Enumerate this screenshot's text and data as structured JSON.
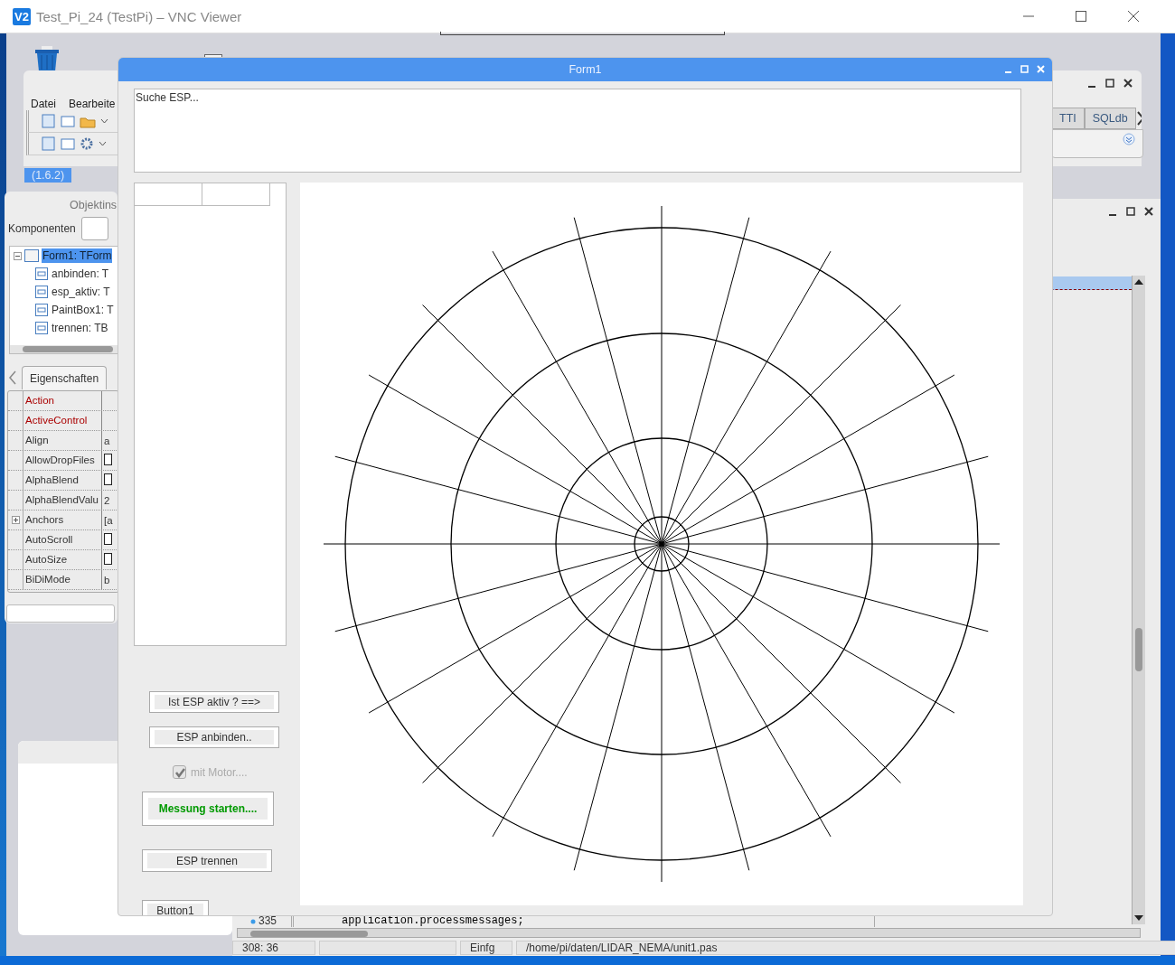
{
  "viewer": {
    "logo": "V2",
    "title": "Test_Pi_24 (TestPi) – VNC Viewer"
  },
  "ide_main": {
    "menu": [
      "Datei",
      "Bearbeite"
    ],
    "version": "(1.6.2)",
    "palette_tabs": [
      {
        "label": "TTI",
        "selected": false
      },
      {
        "label": "SQLdb",
        "selected": false
      }
    ]
  },
  "object_inspector": {
    "title": "Objektins",
    "components_label": "Komponenten",
    "tree": [
      {
        "label": "Form1: TForm",
        "selected": true,
        "expanded": true,
        "children": [
          {
            "label": "anbinden: T",
            "selected": false
          },
          {
            "label": "esp_aktiv: T",
            "selected": false
          },
          {
            "label": "PaintBox1: T",
            "selected": false
          },
          {
            "label": "trennen: TB",
            "selected": false
          }
        ]
      }
    ],
    "tab": "Eigenschaften",
    "properties": [
      {
        "name": "Action",
        "highlighted": true,
        "kind": "text"
      },
      {
        "name": "ActiveControl",
        "highlighted": true,
        "kind": "text"
      },
      {
        "name": "Align",
        "highlighted": false,
        "kind": "text",
        "value": "a"
      },
      {
        "name": "AllowDropFiles",
        "highlighted": false,
        "kind": "checkbox",
        "checked": false
      },
      {
        "name": "AlphaBlend",
        "highlighted": false,
        "kind": "checkbox",
        "checked": false
      },
      {
        "name": "AlphaBlendValu",
        "highlighted": false,
        "kind": "text",
        "value": "2"
      },
      {
        "name": "Anchors",
        "highlighted": false,
        "kind": "text",
        "value": "[a",
        "expandable": true
      },
      {
        "name": "AutoScroll",
        "highlighted": false,
        "kind": "checkbox",
        "checked": false
      },
      {
        "name": "AutoSize",
        "highlighted": false,
        "kind": "checkbox",
        "checked": false
      },
      {
        "name": "BiDiMode",
        "highlighted": false,
        "kind": "text",
        "value": "b"
      }
    ]
  },
  "editor": {
    "line_number": "335",
    "code": "application.processmessages;",
    "status_bar": [
      "308:  36",
      "Einfg",
      "/home/pi/daten/LIDAR_NEMA/unit1.pas"
    ]
  },
  "form1": {
    "title": "Form1",
    "memo": "Suche ESP...",
    "controls": [
      {
        "kind": "button",
        "label": "Ist ESP aktiv ?  ==>"
      },
      {
        "kind": "button",
        "label": "ESP anbinden.."
      },
      {
        "kind": "checkbox",
        "label": "mit Motor....",
        "checked": true,
        "disabled": true
      },
      {
        "kind": "button",
        "label": "Messung starten....",
        "emphasis": true
      },
      {
        "kind": "button",
        "label": "ESP trennen"
      },
      {
        "kind": "button",
        "label": "Button1"
      }
    ]
  }
}
